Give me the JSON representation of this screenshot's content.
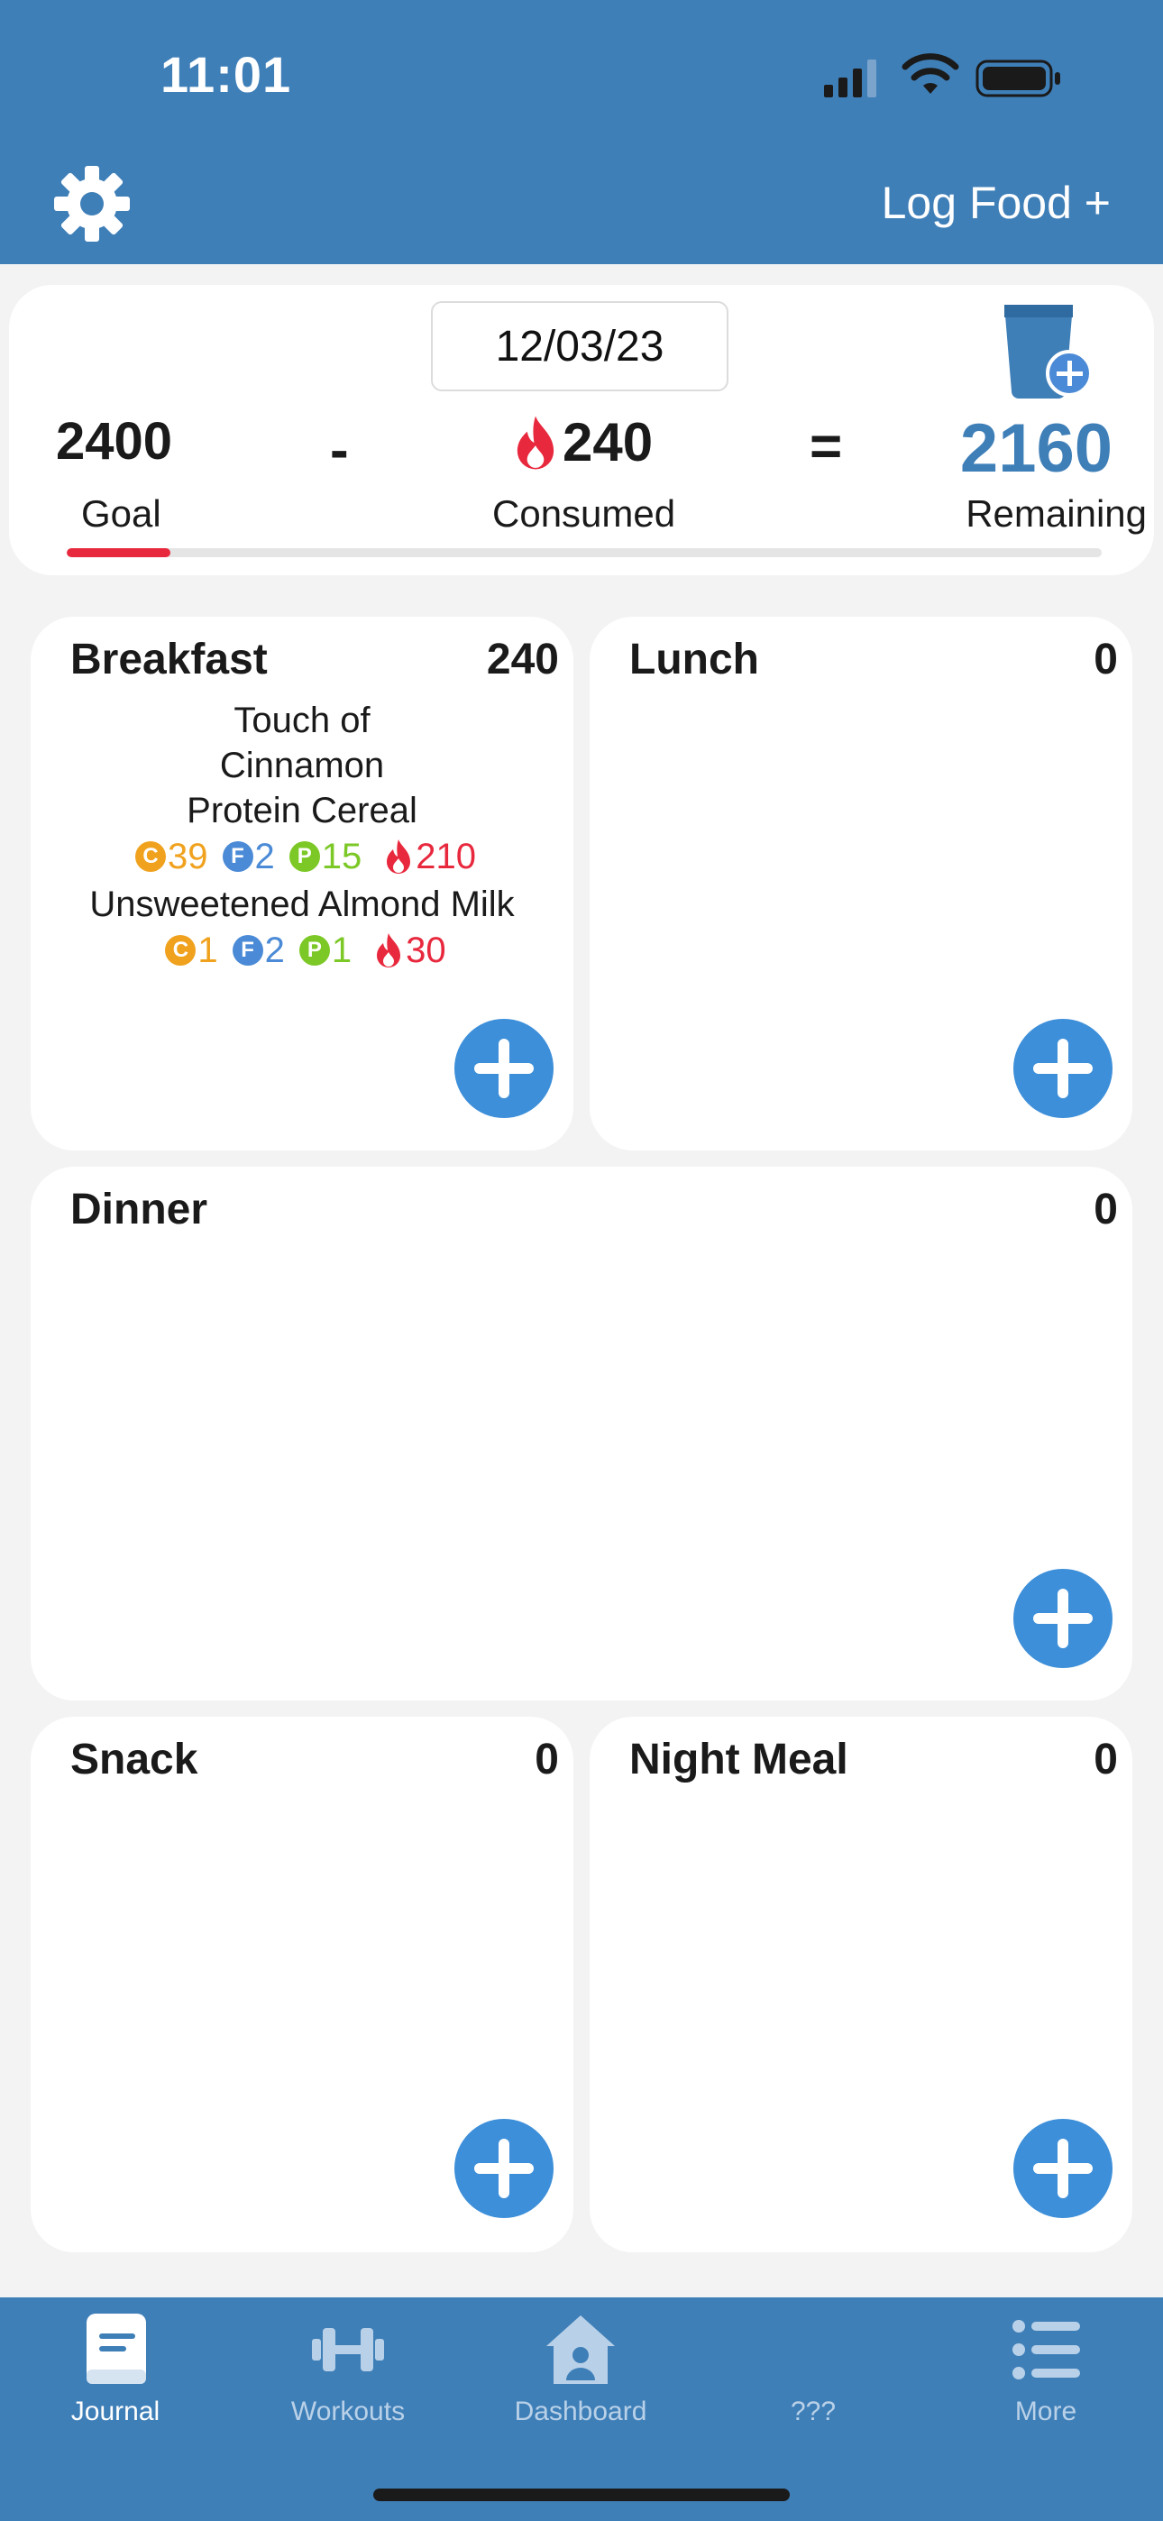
{
  "status_bar": {
    "time": "11:01"
  },
  "header": {
    "settings_icon": "gear-icon",
    "log_food_label": "Log Food +"
  },
  "summary": {
    "date": "12/03/23",
    "goal_value": "2400",
    "goal_label": "Goal",
    "minus_sign": "-",
    "consumed_value": "240",
    "consumed_label": "Consumed",
    "equals_sign": "=",
    "remaining_value": "2160",
    "remaining_label": "Remaining",
    "progress_fraction": 0.1,
    "colors": {
      "accent": "#3f7fb8",
      "progress": "#e8283d"
    }
  },
  "meals": {
    "breakfast": {
      "title": "Breakfast",
      "total": "240",
      "foods": [
        {
          "name": "Touch of Cinnamon Protein Cereal",
          "carbs": "39",
          "fat": "2",
          "protein": "15",
          "calories": "210"
        },
        {
          "name": "Unsweetened Almond Milk",
          "carbs": "1",
          "fat": "2",
          "protein": "1",
          "calories": "30"
        }
      ]
    },
    "lunch": {
      "title": "Lunch",
      "total": "0"
    },
    "dinner": {
      "title": "Dinner",
      "total": "0"
    },
    "snack": {
      "title": "Snack",
      "total": "0"
    },
    "night_meal": {
      "title": "Night Meal",
      "total": "0"
    }
  },
  "macro_badges": {
    "carbs": "C",
    "fat": "F",
    "protein": "P"
  },
  "tabbar": {
    "tabs": [
      {
        "label": "Journal",
        "icon": "journal-icon",
        "active": true
      },
      {
        "label": "Workouts",
        "icon": "dumbbell-icon",
        "active": false
      },
      {
        "label": "Dashboard",
        "icon": "home-icon",
        "active": false
      },
      {
        "label": "???",
        "icon": "",
        "active": false
      },
      {
        "label": "More",
        "icon": "list-icon",
        "active": false
      }
    ]
  }
}
